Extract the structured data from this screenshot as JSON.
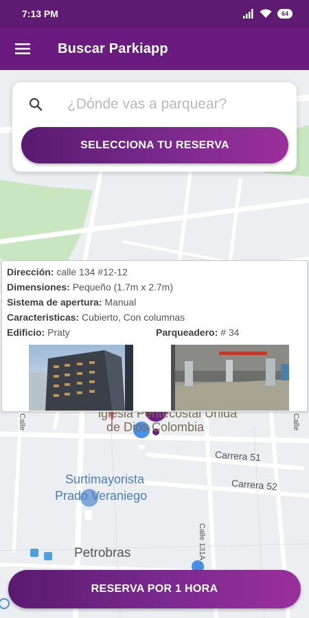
{
  "status_bar": {
    "time": "7:13 PM",
    "battery": "64"
  },
  "app_bar": {
    "title": "Buscar Parkiapp"
  },
  "search": {
    "placeholder": "¿Dónde vas a parquear?",
    "select_button": "SELECCIONA TU RESERVA"
  },
  "info_window": {
    "direccion_label": "Dirección:",
    "direccion_value": "calle 134 #12-12",
    "dimensiones_label": "Dimensiones:",
    "dimensiones_value": "Pequeño (1.7m x 2.7m)",
    "sistema_label": "Sistema de apertura:",
    "sistema_value": "Manual",
    "caracteristicas_label": "Caracteristicas:",
    "caracteristicas_value": "Cubierto, Con columnas",
    "edificio_label": "Edificio:",
    "edificio_value": "Praty",
    "parqueadero_label": "Parqueadero:",
    "parqueadero_value": "# 34"
  },
  "map": {
    "labels": {
      "church_line1": "iglesia Pentecostal Unida",
      "church_line2": "de Dios Colombia",
      "carrera51": "Carrera 51",
      "carrera52": "Carrera 52",
      "surtimayorista_line1": "Surtimayorista",
      "surtimayorista_line2": "Prado Veraniego",
      "petrobras": "Petrobras",
      "calle131a": "Calle 131A",
      "calle_left": "Calle",
      "calle_right": "Calle"
    }
  },
  "reserve_button": {
    "label": "RESERVA POR 1 HORA"
  },
  "colors": {
    "primary": "#6a1b80",
    "status_bar": "#5f1a72",
    "accent_gradient_end": "#9b2f9a",
    "park_green": "#c8e6c0"
  }
}
